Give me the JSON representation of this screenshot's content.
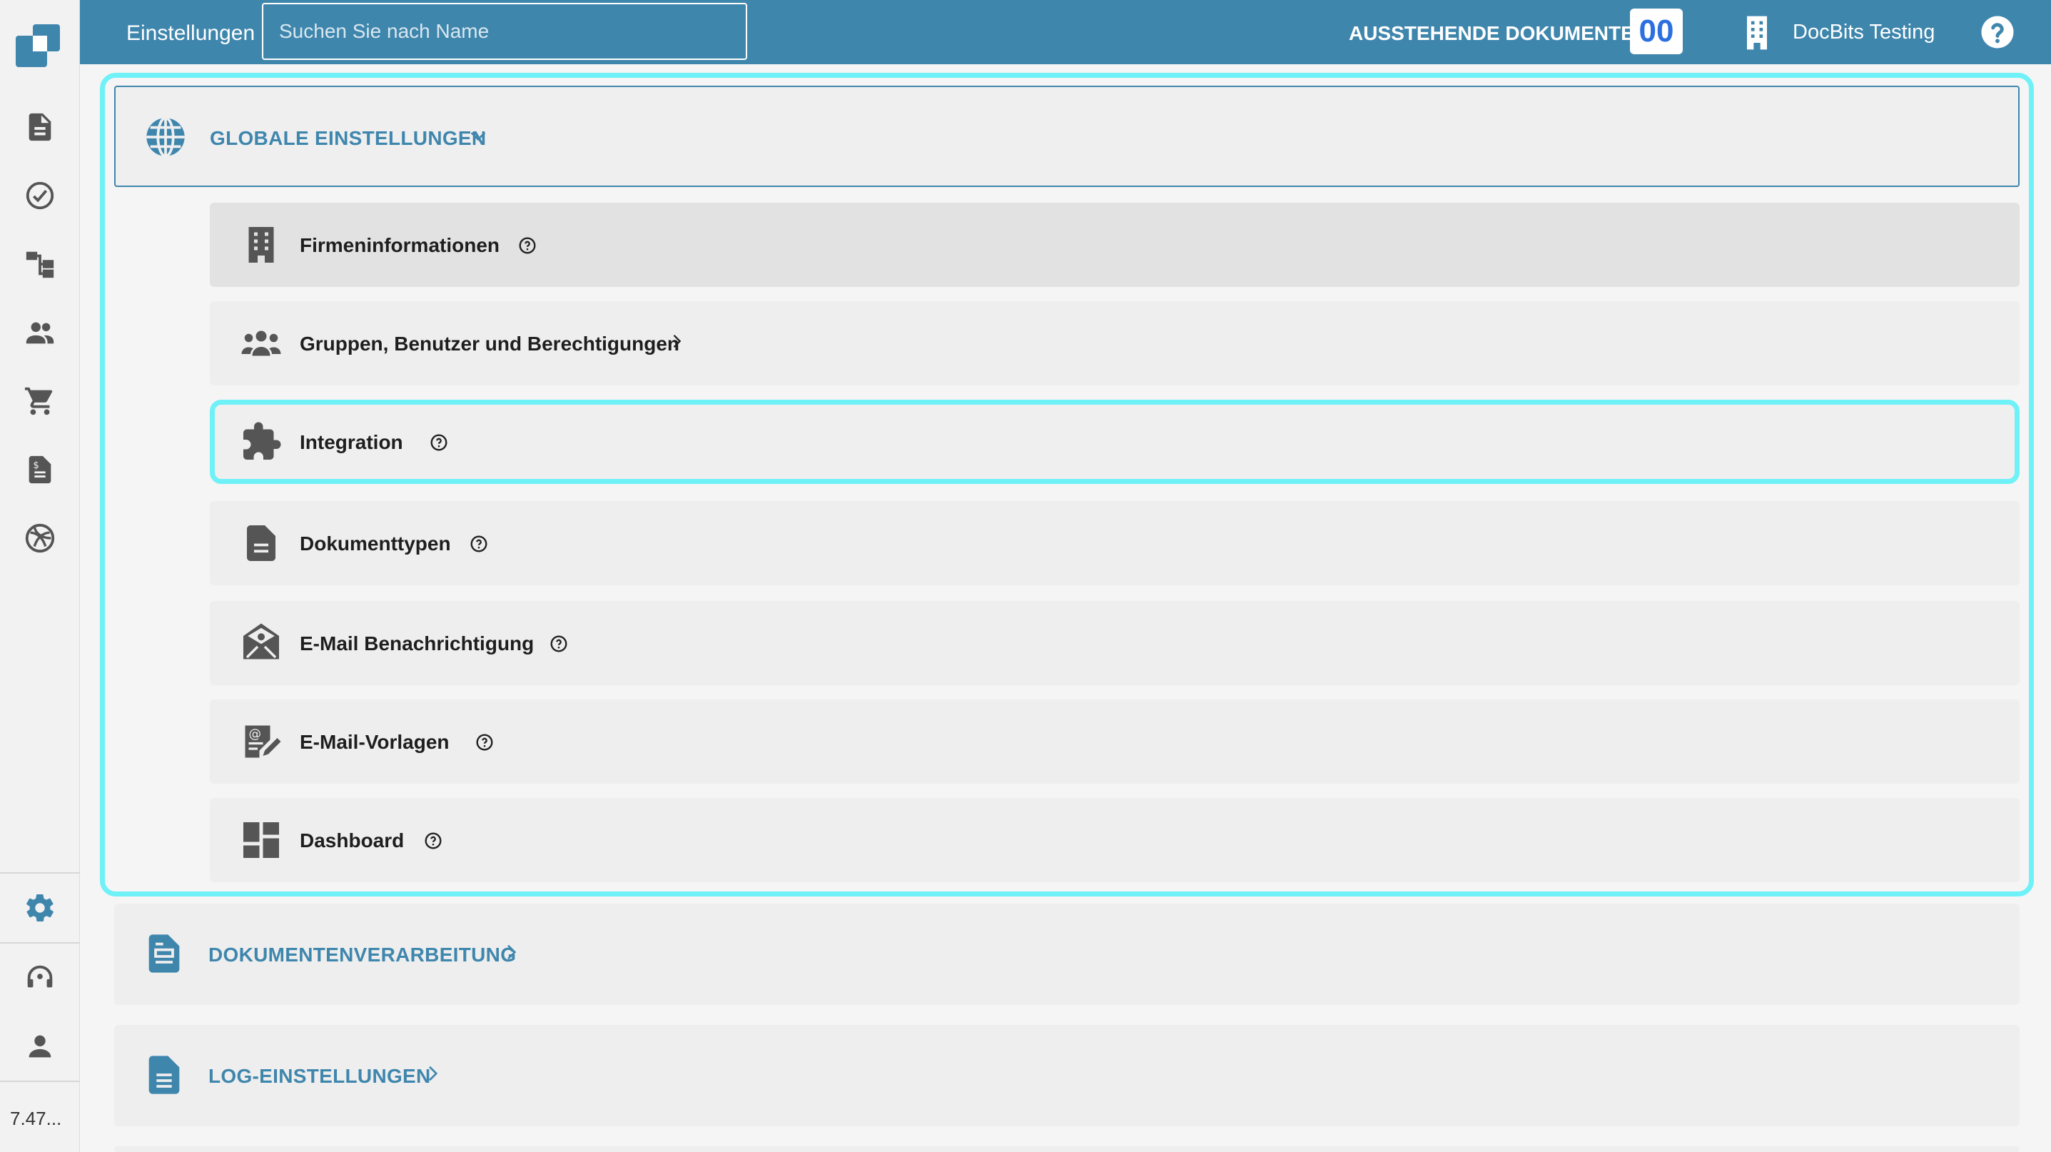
{
  "header": {
    "title": "Einstellungen",
    "search_placeholder": "Suchen Sie nach Name",
    "pending_label": "AUSSTEHENDE DOKUMENTE:",
    "pending_count": "00",
    "org_name": "DocBits Testing"
  },
  "sidebar": {
    "items": [
      {
        "icon": "document-icon"
      },
      {
        "icon": "check-circle-icon"
      },
      {
        "icon": "workflow-icon"
      },
      {
        "icon": "users-icon"
      },
      {
        "icon": "cart-icon"
      },
      {
        "icon": "invoice-icon"
      },
      {
        "icon": "integration-logo-icon"
      },
      {
        "icon": "gear-icon",
        "active": true
      },
      {
        "icon": "support-headset-icon"
      },
      {
        "icon": "person-icon"
      }
    ],
    "version": "7.47..."
  },
  "global_settings": {
    "label": "GLOBALE EINSTELLUNGEN",
    "items": [
      {
        "label": "Firmeninformationen",
        "icon": "building-icon",
        "help": true
      },
      {
        "label": "Gruppen, Benutzer und Berechtigungen",
        "icon": "group-icon",
        "chevron": true
      },
      {
        "label": "Integration",
        "icon": "puzzle-icon",
        "help": true,
        "highlighted": true
      },
      {
        "label": "Dokumenttypen",
        "icon": "document-type-icon",
        "help": true
      },
      {
        "label": "E-Mail Benachrichtigung",
        "icon": "email-notification-icon",
        "help": true
      },
      {
        "label": "E-Mail-Vorlagen",
        "icon": "email-template-icon",
        "help": true
      },
      {
        "label": "Dashboard",
        "icon": "dashboard-icon",
        "help": true
      }
    ]
  },
  "sections": [
    {
      "label": "DOKUMENTENVERARBEITUNG",
      "icon": "doc-processing-icon"
    },
    {
      "label": "LOG-EINSTELLUNGEN",
      "icon": "log-document-icon"
    }
  ],
  "colors": {
    "header_bg": "#3f86ad",
    "accent": "#3f86ad",
    "highlight": "#6ef1f7",
    "badge_text": "#2b6fe0",
    "icon_gray": "#555555"
  }
}
